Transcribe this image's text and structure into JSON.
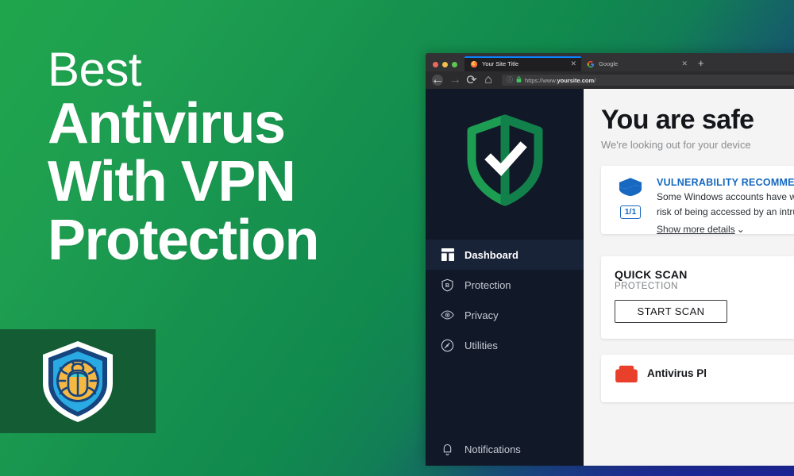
{
  "poster": {
    "headline_small": "Best",
    "headline_lines": [
      "Antivirus",
      "With VPN",
      "Protection"
    ],
    "background": {
      "green": "#1FA64C",
      "mid_green": "#118A4E",
      "blue": "#20288E"
    },
    "logo": {
      "name": "antivirus-shield-bug-logo",
      "panel_color": "#145C33",
      "shield_color": "#29AAE2",
      "shield_outline": "#16447E",
      "bug_body_color": "#F5B843",
      "bug_head_color": "#3FD0C9"
    }
  },
  "browser": {
    "traffic_lights": [
      "red",
      "yellow",
      "green"
    ],
    "tabs": [
      {
        "label": "Your Site Title",
        "favicon": "firefox-icon",
        "active": true,
        "close": "✕"
      },
      {
        "label": "Google",
        "favicon": "google-g-icon",
        "active": false,
        "close": "✕"
      }
    ],
    "new_tab_label": "+",
    "nav": {
      "back": "←",
      "forward": "→",
      "reload": "⟳",
      "home": "⌂"
    },
    "address_bar": {
      "info_icon": "ⓘ",
      "lock_icon": "🔒",
      "url_prefix": "https://www.",
      "url_domain": "yoursite.com",
      "url_suffix": "/"
    }
  },
  "app": {
    "sidebar": {
      "logo_icon": "green-shield-check-icon",
      "items": [
        {
          "label": "Dashboard",
          "icon": "dashboard-grid-icon",
          "active": true
        },
        {
          "label": "Protection",
          "icon": "shield-b-icon",
          "active": false
        },
        {
          "label": "Privacy",
          "icon": "eye-icon",
          "active": false
        },
        {
          "label": "Utilities",
          "icon": "gauge-icon",
          "active": false
        }
      ],
      "bottom_items": [
        {
          "label": "Notifications",
          "icon": "bell-icon"
        }
      ]
    },
    "main": {
      "status_title": "You are safe",
      "status_subtitle": "We're looking out for your device",
      "vulnerability_card": {
        "icon": "blue-shield-icon",
        "count": "1/1",
        "title": "VULNERABILITY RECOMMENDATIONS",
        "text_line1": "Some Windows accounts have weak passwords and are at",
        "text_line2": "risk of being accessed by an intruder.",
        "link": "Show more details",
        "link_chevron": "⌄"
      },
      "quick_scan_card": {
        "title": "QUICK SCAN",
        "subtitle": "PROTECTION",
        "button": "START SCAN",
        "icon": "scan-radar-icon"
      },
      "bottom_card": {
        "icon": "red-antivirus-icon",
        "label": "Antivirus Pl"
      }
    }
  }
}
